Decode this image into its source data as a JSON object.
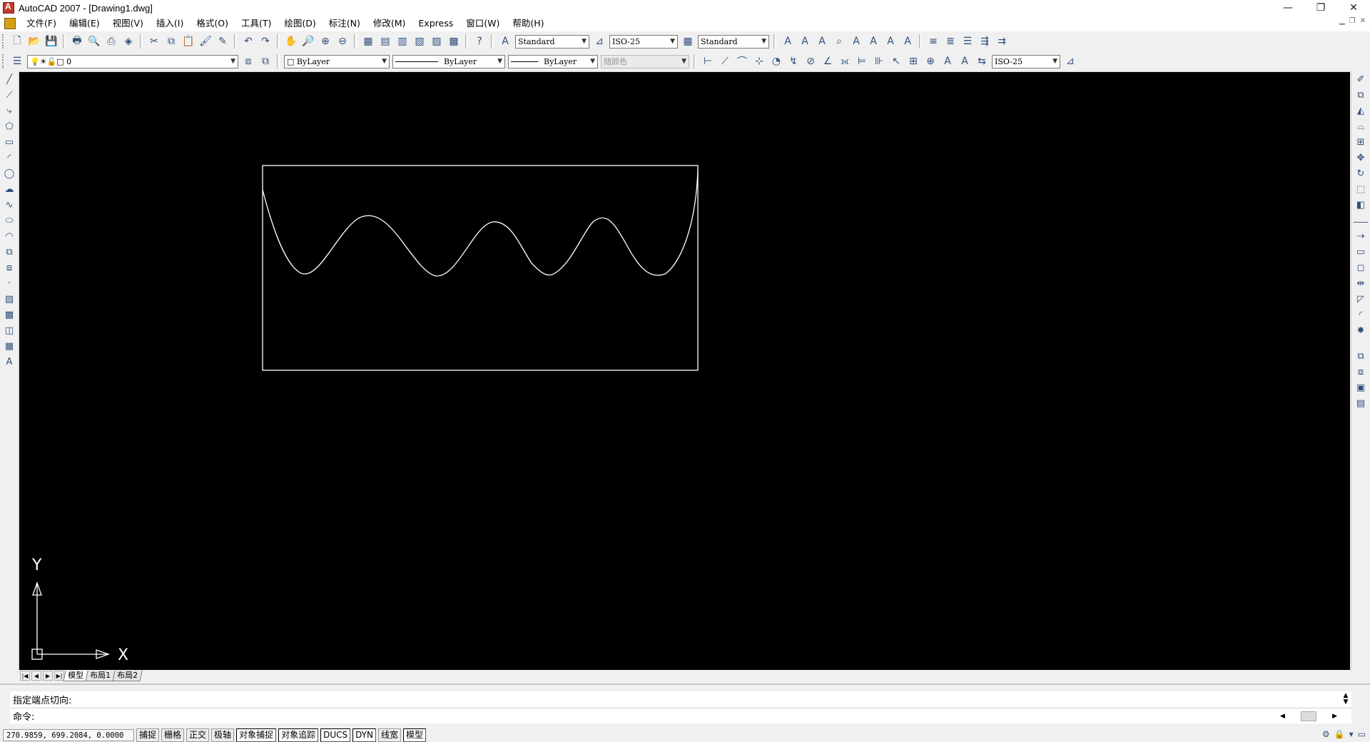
{
  "window": {
    "title": "AutoCAD 2007 - [Drawing1.dwg]",
    "minimize": "—",
    "restore": "❐",
    "close": "✕"
  },
  "menubar": {
    "items": [
      "文件(F)",
      "编辑(E)",
      "视图(V)",
      "插入(I)",
      "格式(O)",
      "工具(T)",
      "绘图(D)",
      "标注(N)",
      "修改(M)",
      "Express",
      "窗口(W)",
      "帮助(H)"
    ]
  },
  "toolbar1": {
    "text_style": "Standard",
    "dim_style": "ISO-25",
    "table_style": "Standard"
  },
  "toolbar2": {
    "layer": "0",
    "color": "ByLayer",
    "linetype": "ByLayer",
    "lineweight": "ByLayer",
    "plotstyle": "随颜色",
    "dim_style2": "ISO-25"
  },
  "ucs": {
    "x_label": "X",
    "y_label": "Y"
  },
  "tabs": [
    "模型",
    "布局1",
    "布局2"
  ],
  "command": {
    "history": "指定端点切向:",
    "prompt": "命令:"
  },
  "status": {
    "coords": "270.9859,  699.2084, 0.0000",
    "toggles": [
      {
        "label": "捕捉",
        "on": false
      },
      {
        "label": "栅格",
        "on": false
      },
      {
        "label": "正交",
        "on": false
      },
      {
        "label": "极轴",
        "on": false
      },
      {
        "label": "对象捕捉",
        "on": true
      },
      {
        "label": "对象追踪",
        "on": true
      },
      {
        "label": "DUCS",
        "on": true
      },
      {
        "label": "DYN",
        "on": true
      },
      {
        "label": "线宽",
        "on": false
      },
      {
        "label": "模型",
        "on": true
      }
    ]
  },
  "colors": {
    "canvas": "#000000",
    "geometry": "#ffffff"
  }
}
